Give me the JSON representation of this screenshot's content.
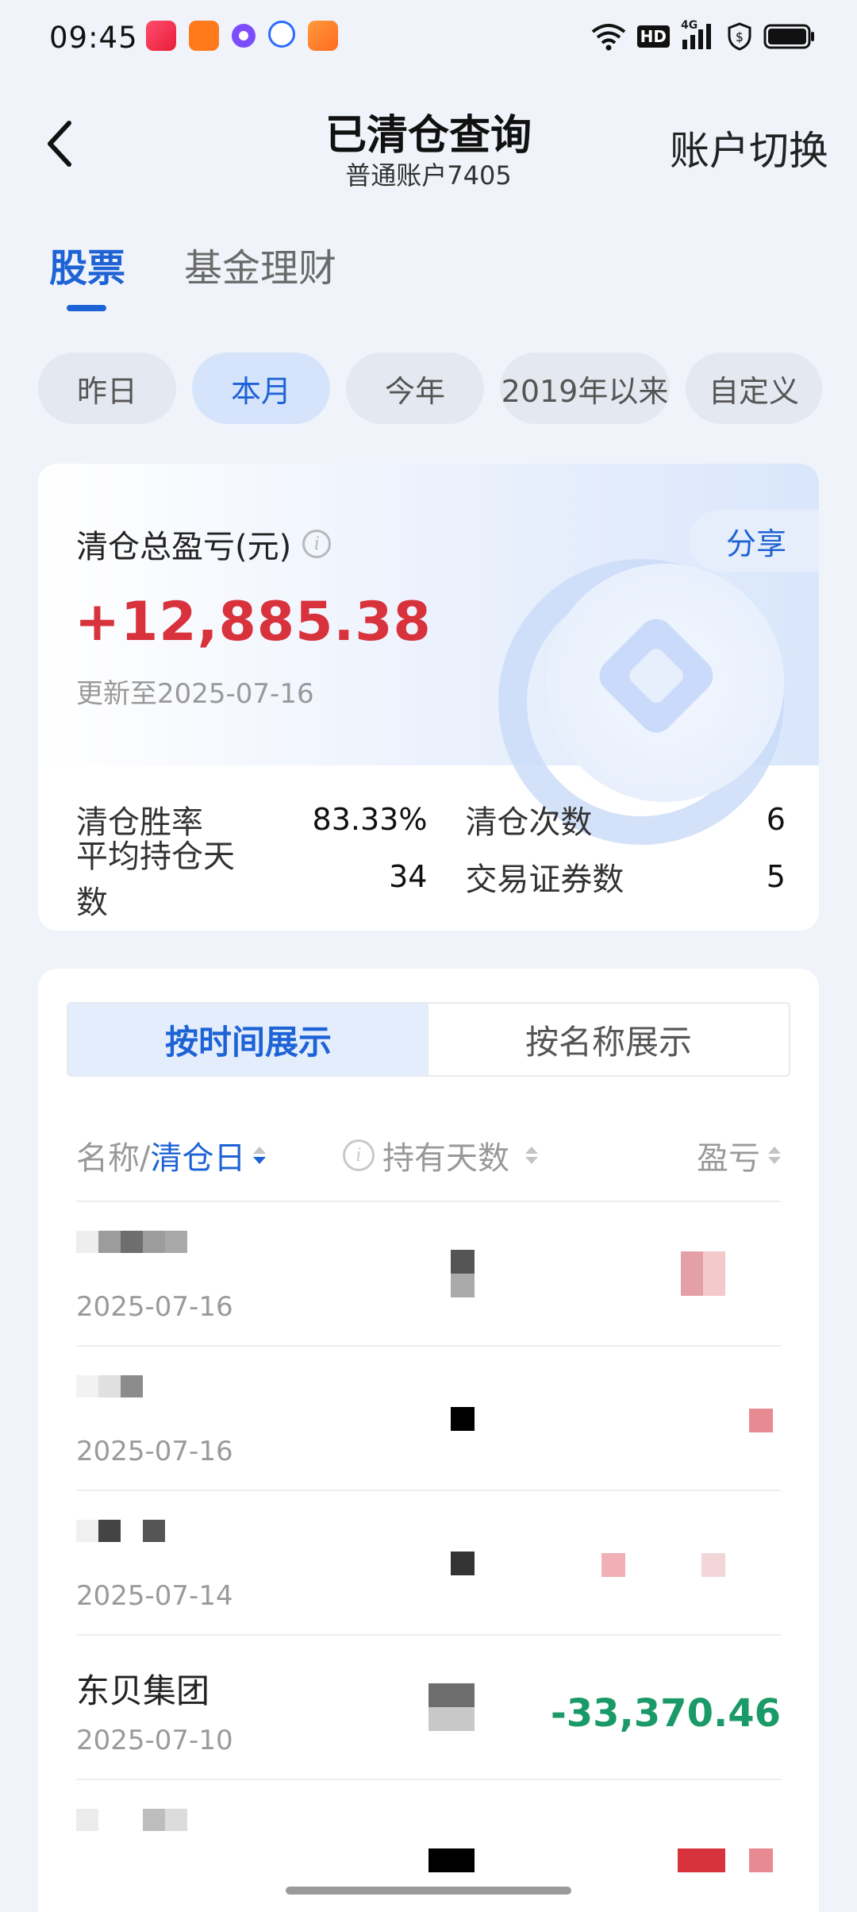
{
  "status_bar": {
    "time": "09:45",
    "hd_label": "HD",
    "network_label": "4G"
  },
  "header": {
    "title": "已清仓查询",
    "subtitle": "普通账户7405",
    "switch_label": "账户切换"
  },
  "top_tabs": [
    {
      "label": "股票",
      "active": true
    },
    {
      "label": "基金理财",
      "active": false
    }
  ],
  "period_chips": [
    {
      "label": "昨日",
      "active": false
    },
    {
      "label": "本月",
      "active": true
    },
    {
      "label": "今年",
      "active": false
    },
    {
      "label": "2019年以来",
      "active": false
    },
    {
      "label": "自定义",
      "active": false
    }
  ],
  "summary": {
    "label": "清仓总盈亏(元)",
    "value": "+12,885.38",
    "updated": "更新至2025-07-16",
    "share_label": "分享",
    "stats": {
      "win_rate_label": "清仓胜率",
      "win_rate_value": "83.33%",
      "count_label": "清仓次数",
      "count_value": "6",
      "avg_days_label": "平均持仓天数",
      "avg_days_value": "34",
      "securities_label": "交易证券数",
      "securities_value": "5"
    }
  },
  "list": {
    "segments": [
      {
        "label": "按时间展示",
        "active": true
      },
      {
        "label": "按名称展示",
        "active": false
      }
    ],
    "header": {
      "name_prefix": "名称/",
      "name_sort": "清仓日",
      "days": "持有天数",
      "pl": "盈亏"
    },
    "rows": [
      {
        "name": "",
        "date": "2025-07-16",
        "pl": "",
        "pl_type": "gain",
        "obscured": true
      },
      {
        "name": "",
        "date": "2025-07-16",
        "pl": "",
        "pl_type": "gain",
        "obscured": true
      },
      {
        "name": "",
        "date": "2025-07-14",
        "pl": "",
        "pl_type": "gain",
        "obscured": true
      },
      {
        "name": "东贝集团",
        "date": "2025-07-10",
        "pl": "-33,370.46",
        "pl_type": "loss",
        "obscured": false
      },
      {
        "name": "",
        "date": "",
        "pl": "",
        "pl_type": "gain",
        "obscured": true
      }
    ]
  },
  "colors": {
    "accent": "#1e63d6",
    "gain": "#d8323c",
    "loss": "#1a9a68",
    "background": "#f0f3fa"
  }
}
